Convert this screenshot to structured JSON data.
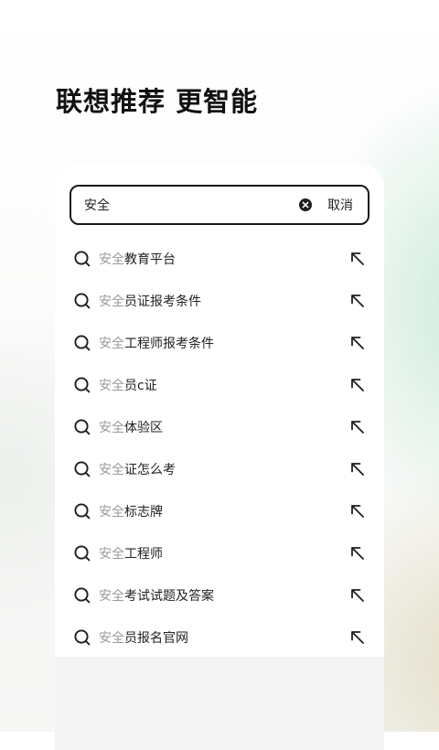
{
  "headline": "联想推荐 更智能",
  "search": {
    "value": "安全",
    "cancel_label": "取消"
  },
  "suggestions": [
    {
      "match": "安全",
      "rest": "教育平台"
    },
    {
      "match": "安全",
      "rest": "员证报考条件"
    },
    {
      "match": "安全",
      "rest": "工程师报考条件"
    },
    {
      "match": "安全",
      "rest": "员c证"
    },
    {
      "match": "安全",
      "rest": "体验区"
    },
    {
      "match": "安全",
      "rest": "证怎么考"
    },
    {
      "match": "安全",
      "rest": "标志牌"
    },
    {
      "match": "安全",
      "rest": "工程师"
    },
    {
      "match": "安全",
      "rest": "考试试题及答案"
    },
    {
      "match": "安全",
      "rest": "员报名官网"
    }
  ],
  "icons": {
    "search": "search-icon",
    "clear": "clear-icon",
    "fill": "arrow-up-left-icon"
  },
  "colors": {
    "text": "#222222",
    "match_highlight": "#9a9a9a",
    "border": "#1a1a1a"
  }
}
